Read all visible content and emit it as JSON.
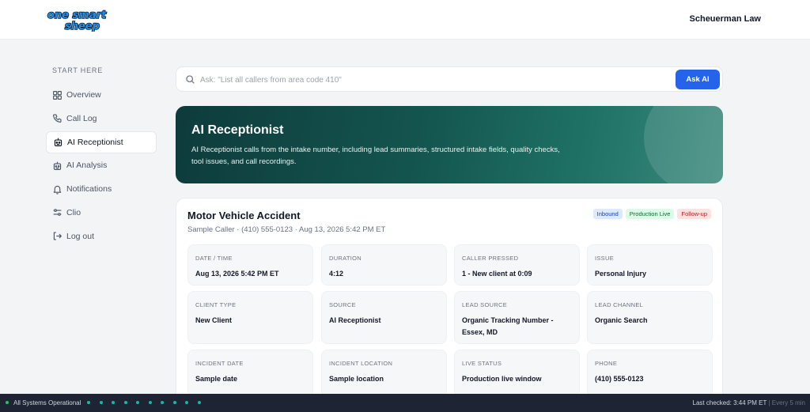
{
  "header": {
    "logo_text": [
      "one smart",
      "sheep"
    ],
    "org_name": "Scheuerman Law"
  },
  "sidebar": {
    "heading": "START HERE",
    "items": [
      {
        "label": "Overview",
        "icon": "grid-icon",
        "active": false
      },
      {
        "label": "Call Log",
        "icon": "phone-icon",
        "active": false
      },
      {
        "label": "AI Receptionist",
        "icon": "robot-icon",
        "active": true
      },
      {
        "label": "AI Analysis",
        "icon": "robot-icon",
        "active": false
      },
      {
        "label": "Notifications",
        "icon": "bell-icon",
        "active": false
      },
      {
        "label": "Clio",
        "icon": "sliders-icon",
        "active": false
      },
      {
        "label": "Log out",
        "icon": "logout-icon",
        "active": false
      }
    ]
  },
  "search": {
    "value": "",
    "placeholder": "Ask: \"List all callers from area code 410\"",
    "button_label": "Ask AI"
  },
  "hero": {
    "title": "AI Receptionist",
    "description": "AI Receptionist calls from the intake number, including lead summaries, structured intake fields, quality checks, tool issues, and call recordings."
  },
  "call_card": {
    "title": "Motor Vehicle Accident",
    "subtitle": "Sample Caller · (410) 555-0123 · Aug 13, 2026 5:42 PM ET",
    "tags": [
      "Inbound",
      "Production Live",
      "Follow-up"
    ],
    "fields": [
      {
        "label": "DATE / TIME",
        "value": "Aug 13, 2026 5:42 PM ET"
      },
      {
        "label": "DURATION",
        "value": "4:12"
      },
      {
        "label": "CALLER PRESSED",
        "value": "1 - New client at 0:09"
      },
      {
        "label": "ISSUE",
        "value": "Personal Injury"
      },
      {
        "label": "CLIENT TYPE",
        "value": "New Client"
      },
      {
        "label": "SOURCE",
        "value": "AI Receptionist"
      },
      {
        "label": "LEAD SOURCE",
        "value": "Organic Tracking Number - Essex, MD"
      },
      {
        "label": "LEAD CHANNEL",
        "value": "Organic Search"
      },
      {
        "label": "INCIDENT DATE",
        "value": "Sample date"
      },
      {
        "label": "INCIDENT LOCATION",
        "value": "Sample location"
      },
      {
        "label": "LIVE STATUS",
        "value": "Production live window"
      },
      {
        "label": "PHONE",
        "value": "(410) 555-0123"
      }
    ]
  },
  "statusbar": {
    "status": "All Systems Operational",
    "last_checked": "Last checked: 3:44 PM ET",
    "frequency": "Every 5 min"
  },
  "colors": {
    "accent": "#2563eb",
    "hero_start": "#0e3b3c",
    "hero_end": "#3e8a7e",
    "status_ok": "#22c55e"
  }
}
